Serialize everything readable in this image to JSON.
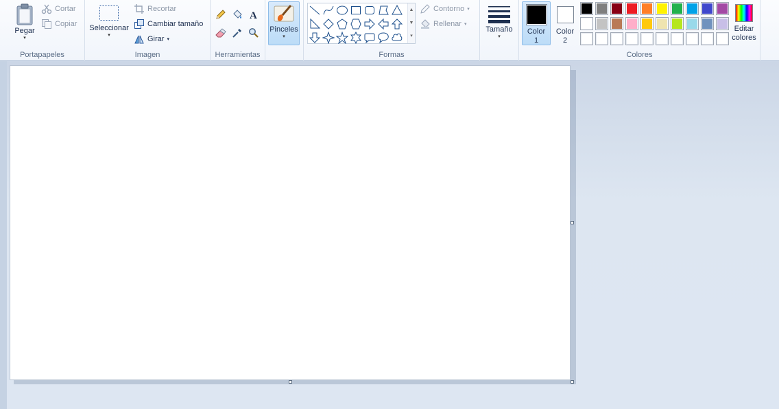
{
  "ribbon": {
    "groups": {
      "clipboard": "Portapapeles",
      "image": "Imagen",
      "tools": "Herramientas",
      "shapes": "Formas",
      "colors": "Colores"
    },
    "clipboard": {
      "paste": "Pegar",
      "cut": "Cortar",
      "copy": "Copiar"
    },
    "image": {
      "select": "Seleccionar",
      "crop": "Recortar",
      "resize": "Cambiar tamaño",
      "rotate": "Girar"
    },
    "brushes": "Pinceles",
    "shapes": {
      "outline": "Contorno",
      "fill": "Rellenar"
    },
    "size": "Tamaño",
    "colors": {
      "color1_line1": "Color",
      "color1_line2": "1",
      "color2_line1": "Color",
      "color2_line2": "2",
      "edit_line1": "Editar",
      "edit_line2": "colores",
      "color1_value": "#000000",
      "color2_value": "#ffffff",
      "palette_row1": [
        "#000000",
        "#7f7f7f",
        "#880015",
        "#ed1c24",
        "#ff7f27",
        "#fff200",
        "#22b14c",
        "#00a2e8",
        "#3f48cc",
        "#a349a4"
      ],
      "palette_row2": [
        "#ffffff",
        "#c3c3c3",
        "#b97a57",
        "#ffaec9",
        "#ffc90e",
        "#efe4b0",
        "#b5e61d",
        "#99d9ea",
        "#7092be",
        "#c8bfe7"
      ],
      "palette_row3_empty": 10
    }
  },
  "icons": {
    "cut": "scissors-icon",
    "copy": "copy-icon",
    "crop": "crop-icon",
    "resize": "resize-icon",
    "rotate": "rotate-icon",
    "pencil": "pencil-icon",
    "fill": "bucket-fill-icon",
    "text": "text-icon",
    "eraser": "eraser-icon",
    "picker": "color-picker-icon",
    "magnifier": "magnifier-icon",
    "shapes": [
      "line",
      "curve",
      "oval",
      "rectangle",
      "rounded-rectangle",
      "polygon",
      "triangle",
      "right-triangle",
      "diamond",
      "pentagon",
      "hexagon",
      "right-arrow",
      "left-arrow",
      "up-arrow",
      "down-arrow",
      "four-point-star",
      "five-point-star",
      "six-point-star",
      "rounded-callout",
      "oval-callout",
      "cloud-callout"
    ]
  },
  "accent": "#2b6cb0",
  "selected_bg": "#cde4fa"
}
